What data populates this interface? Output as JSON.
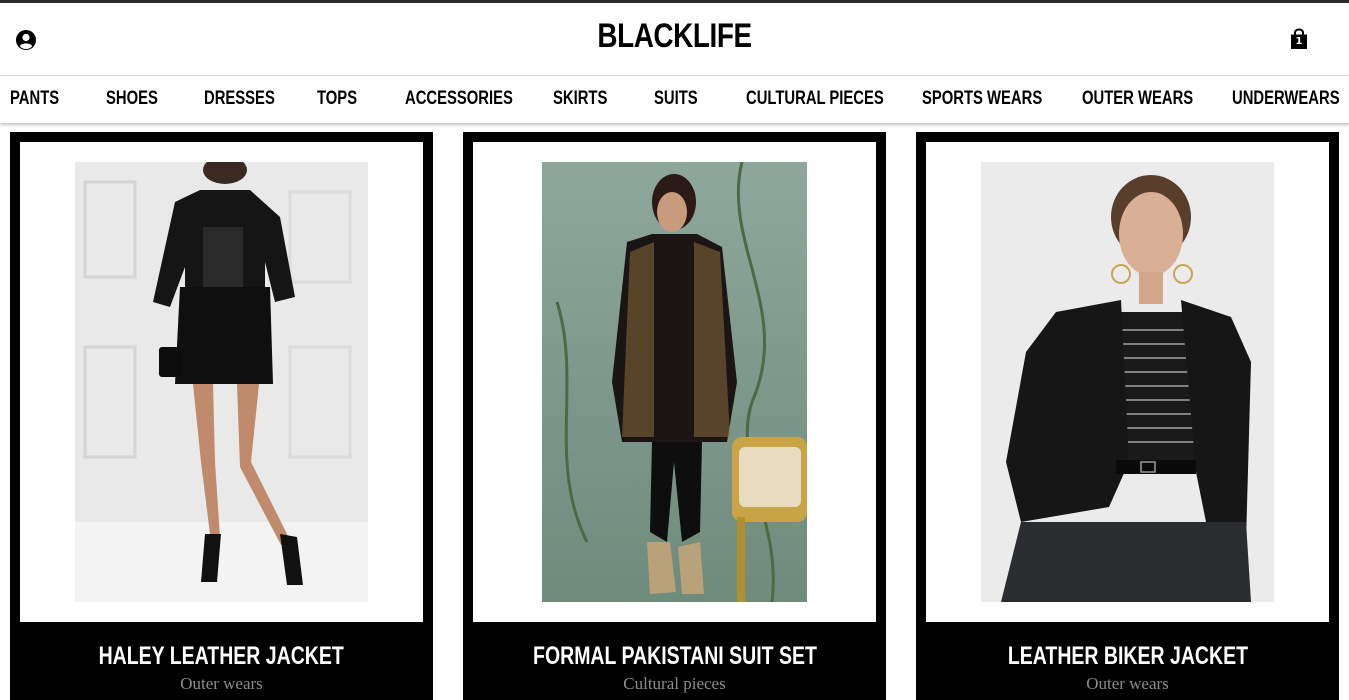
{
  "header": {
    "brand": "BLACKLIFE",
    "user_icon": "user-circle-icon",
    "cart_icon": "shopping-bag-icon",
    "cart_count": "1"
  },
  "nav": {
    "items": [
      {
        "label": "PANTS"
      },
      {
        "label": "SHOES"
      },
      {
        "label": "DRESSES"
      },
      {
        "label": "TOPS"
      },
      {
        "label": "ACCESSORIES"
      },
      {
        "label": "SKIRTS"
      },
      {
        "label": "SUITS"
      },
      {
        "label": "CULTURAL PIECES"
      },
      {
        "label": "SPORTS WEARS"
      },
      {
        "label": "OUTER WEARS"
      },
      {
        "label": "UNDERWEARS"
      }
    ]
  },
  "products": [
    {
      "title": "HALEY LEATHER JACKET",
      "category": "Outer wears"
    },
    {
      "title": "FORMAL PAKISTANI SUIT SET",
      "category": "Cultural pieces"
    },
    {
      "title": "LEATHER BIKER JACKET",
      "category": "Outer wears"
    }
  ],
  "colors": {
    "primary": "#000000",
    "background": "#ffffff",
    "muted_text": "#8c8c8c"
  }
}
